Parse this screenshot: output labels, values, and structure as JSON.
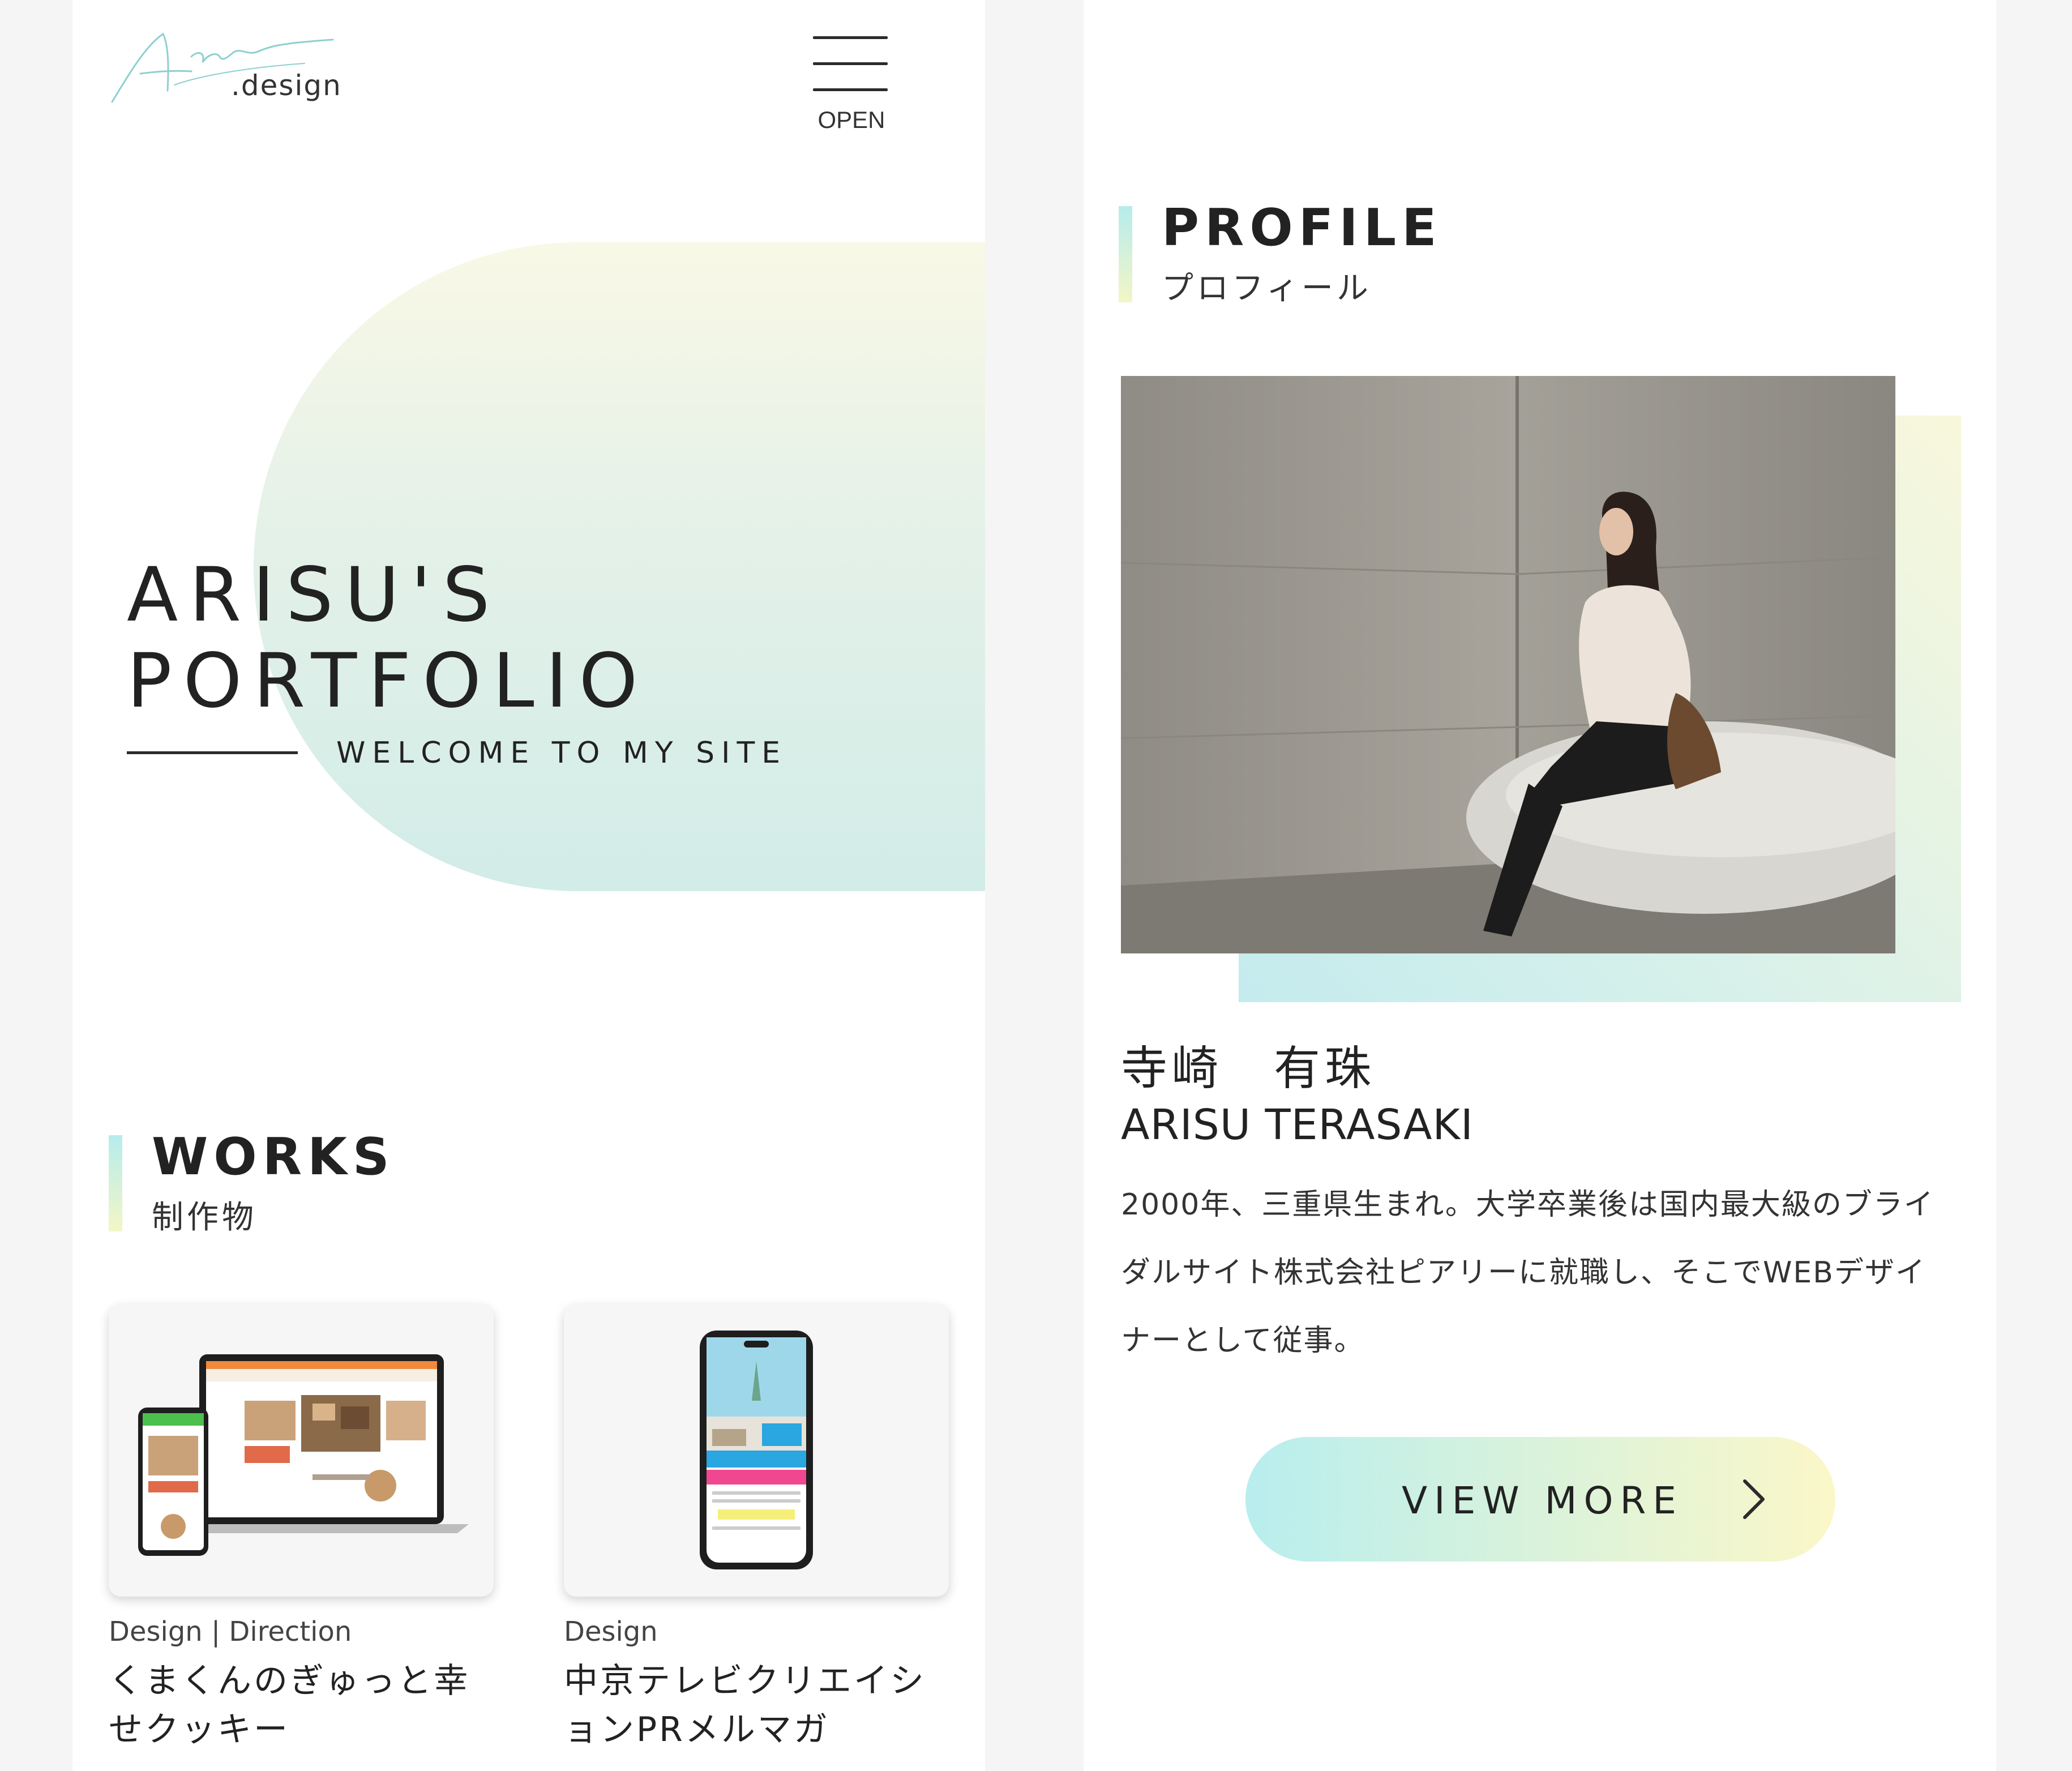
{
  "left_panel": {
    "logo": {
      "script": "Arisu",
      "text": ".design"
    },
    "menu": {
      "label": "OPEN"
    },
    "hero": {
      "title_line1": "ARISU'S",
      "title_line2": "PORTFOLIO",
      "subtitle": "WELCOME TO MY SITE"
    },
    "works": {
      "title": "WORKS",
      "subtitle": "制作物",
      "items": [
        {
          "tag": "Design | Direction",
          "name": "くまくんのぎゅっと幸せクッキー"
        },
        {
          "tag": "Design",
          "name": "中京テレビクリエイションPRメルマガ"
        }
      ]
    }
  },
  "right_panel": {
    "profile": {
      "title": "PROFILE",
      "subtitle": "プロフィール"
    },
    "person": {
      "name_jp": "寺崎　有珠",
      "name_en": "ARISU TERASAKI",
      "bio": "2000年、三重県生まれ。大学卒業後は国内最大級のブライダルサイト株式会社ピアリーに就職し、そこでWEBデザイナーとして従事。"
    },
    "button": {
      "label": "VIEW MORE"
    }
  },
  "colors": {
    "accent_mint": "#b8eeee",
    "accent_yellow": "#fbf7c8",
    "text": "#222222",
    "page_bg": "#f5f5f5"
  },
  "icons": [
    "hamburger-menu-icon",
    "chevron-right-icon"
  ]
}
